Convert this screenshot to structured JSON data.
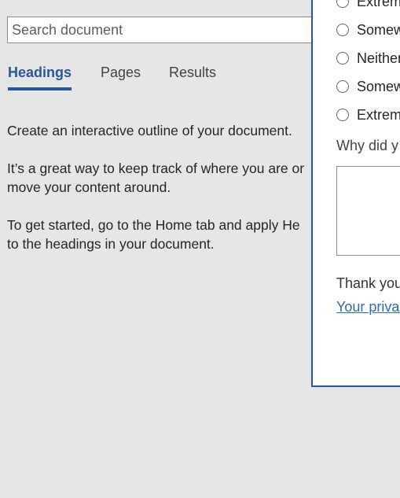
{
  "navigation_pane": {
    "search": {
      "placeholder": "Search document",
      "value": ""
    },
    "tabs": [
      {
        "label": "Headings",
        "active": true
      },
      {
        "label": "Pages",
        "active": false
      },
      {
        "label": "Results",
        "active": false
      }
    ],
    "message": {
      "p1": "Create an interactive outline of your document.",
      "p2_line1": "It’s a great way to keep track of where you are or",
      "p2_line2": "move your content around.",
      "p3_line1": "To get started, go to the Home tab and apply He",
      "p3_line2": "to the headings in your document."
    }
  },
  "feedback_dialog": {
    "options": [
      {
        "label": "Extrem"
      },
      {
        "label": "Somew"
      },
      {
        "label": "Neither"
      },
      {
        "label": "Somew"
      },
      {
        "label": "Extrem"
      }
    ],
    "why_label": "Why did y",
    "why_value": "",
    "thanks_text": "Thank you",
    "privacy_link": "Your privac"
  },
  "colors": {
    "accent": "#2b579a",
    "background": "#e6e6e6",
    "link": "#2b6cb0"
  }
}
